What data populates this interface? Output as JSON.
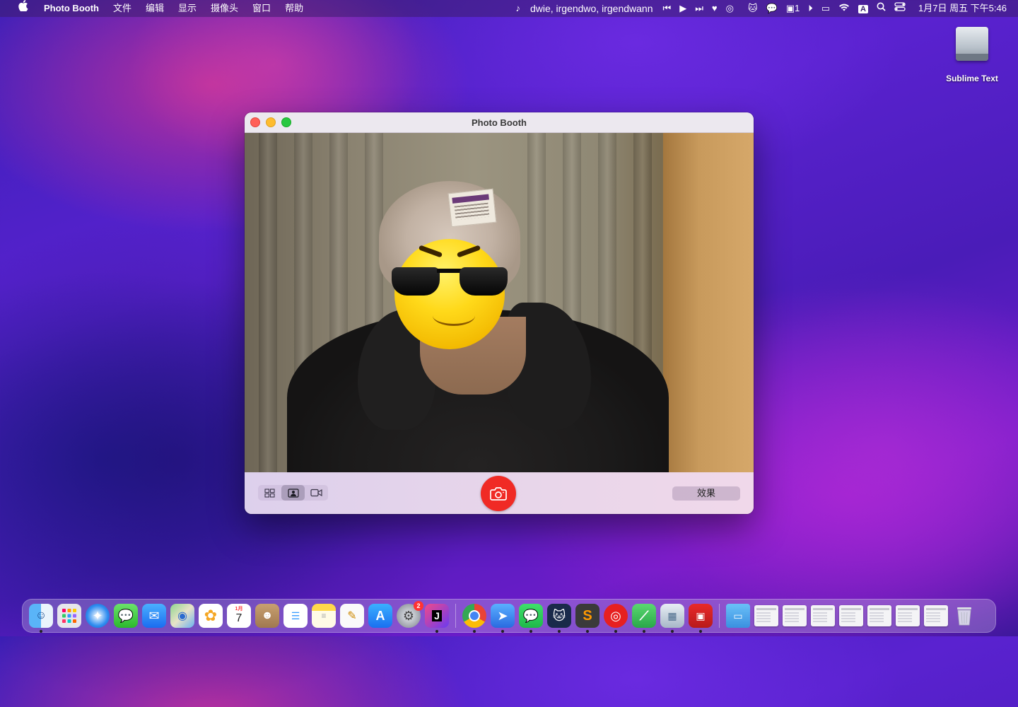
{
  "menubar": {
    "apple": "",
    "app_name": "Photo Booth",
    "menus": [
      "文件",
      "编辑",
      "显示",
      "摄像头",
      "窗口",
      "帮助"
    ],
    "now_playing": "dwie, irgendwo, irgendwann",
    "weibo_count": "1",
    "input_method": "A",
    "clock": "1月7日 周五 下午5:46"
  },
  "desktop": {
    "drive_label": "Sublime Text"
  },
  "window": {
    "title": "Photo Booth",
    "effects_label": "效果"
  },
  "dock": {
    "settings_badge": "2",
    "calendar_month": "1月",
    "calendar_day": "7"
  }
}
